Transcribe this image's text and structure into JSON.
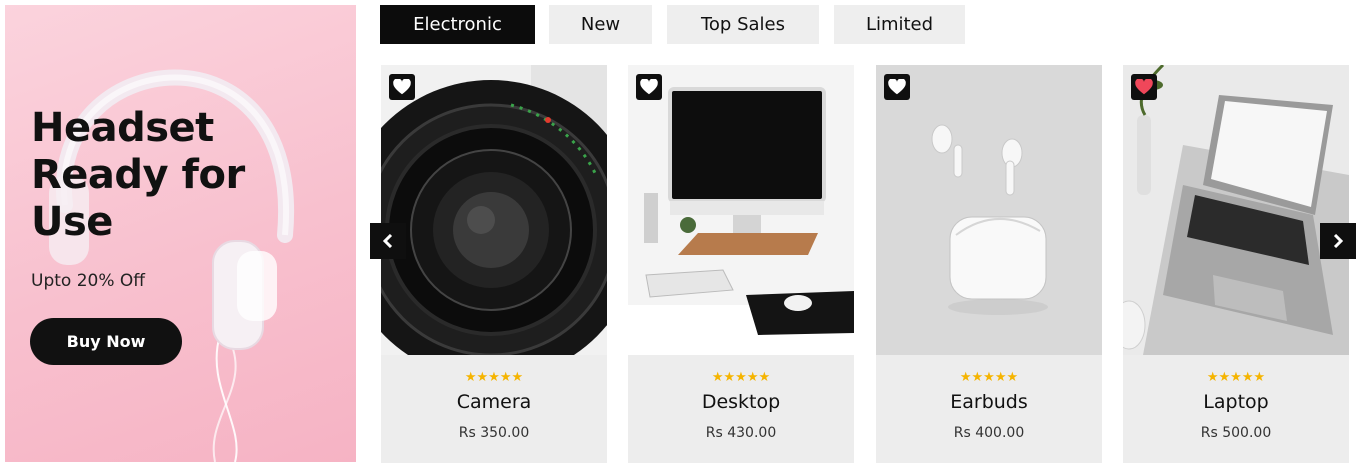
{
  "promo": {
    "title": "Headset Ready for Use",
    "subtitle": "Upto 20% Off",
    "button_label": "Buy Now"
  },
  "tabs": [
    {
      "label": "Electronic",
      "active": true
    },
    {
      "label": "New",
      "active": false
    },
    {
      "label": "Top Sales",
      "active": false
    },
    {
      "label": "Limited",
      "active": false
    }
  ],
  "products": [
    {
      "name": "Camera",
      "price": "Rs 350.00",
      "stars": "★★★★★",
      "rating": 5,
      "favorited": false
    },
    {
      "name": "Desktop",
      "price": "Rs 430.00",
      "stars": "★★★★★",
      "rating": 5,
      "favorited": false
    },
    {
      "name": "Earbuds",
      "price": "Rs 400.00",
      "stars": "★★★★★",
      "rating": 5,
      "favorited": false
    },
    {
      "name": "Laptop",
      "price": "Rs 500.00",
      "stars": "★★★★★",
      "rating": 5,
      "favorited": true
    }
  ],
  "icons": {
    "prev": "chevron-left-icon",
    "next": "chevron-right-icon",
    "wishlist": "heart-icon"
  },
  "colors": {
    "accent": "#0c0c0c",
    "star": "#f5b400",
    "heart_active": "#f0475a",
    "heart_inactive": "#ffffff",
    "promo_bg": "#f8c0ce"
  }
}
